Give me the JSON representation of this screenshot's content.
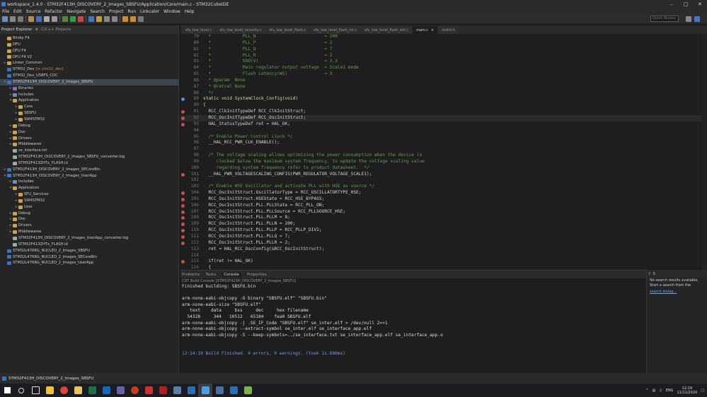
{
  "window": {
    "title": "workspace_1.4.0 - STM32F413H_DISCOVERY_2_Images_SBSFU/Application/Core/main.c - STM32CubeIDE"
  },
  "menu": [
    "File",
    "Edit",
    "Source",
    "Refactor",
    "Navigate",
    "Search",
    "Project",
    "Run",
    "Linkcalor",
    "Window",
    "Help"
  ],
  "toolbar": {
    "quick_access_placeholder": "Quick Access"
  },
  "left_tabs": {
    "project_explorer": "Project Explorer",
    "cpp_projects": "C/C++ Projects"
  },
  "tree": [
    {
      "label": "Blinky F4",
      "level": 0,
      "twisty": "",
      "icon": "folder"
    },
    {
      "label": "DFU",
      "level": 0,
      "twisty": "",
      "icon": "folder"
    },
    {
      "label": "DFU F4",
      "level": 0,
      "twisty": "",
      "icon": "folder"
    },
    {
      "label": "DFU F4 V2",
      "level": 0,
      "twisty": "",
      "icon": "folder"
    },
    {
      "label": "Linker_Common",
      "level": 0,
      "twisty": ">",
      "icon": "folder"
    },
    {
      "label": "STM32_Dev",
      "anno": "[in stm32_dev]",
      "level": 0,
      "twisty": "",
      "icon": "proj"
    },
    {
      "label": "STM32_Dev_USBFS_CDC",
      "level": 0,
      "twisty": "",
      "icon": "proj"
    },
    {
      "label": "STM32F413H_DISCOVERY_2_Images_SBSFU",
      "level": 0,
      "twisty": "v",
      "icon": "proj",
      "selected": true
    },
    {
      "label": "Binaries",
      "level": 1,
      "twisty": ">",
      "icon": "bin"
    },
    {
      "label": "Includes",
      "level": 1,
      "twisty": ">",
      "icon": "inc"
    },
    {
      "label": "Application",
      "level": 1,
      "twisty": "v",
      "icon": "folder"
    },
    {
      "label": "Core",
      "level": 2,
      "twisty": ">",
      "icon": "folder"
    },
    {
      "label": "SBSFU",
      "level": 2,
      "twisty": ">",
      "icon": "folder"
    },
    {
      "label": "SW4STM32",
      "level": 2,
      "twisty": ">",
      "icon": "folder"
    },
    {
      "label": "Debug",
      "level": 1,
      "twisty": ">",
      "icon": "folder"
    },
    {
      "label": "Doc",
      "level": 1,
      "twisty": ">",
      "icon": "folder"
    },
    {
      "label": "Drivers",
      "level": 1,
      "twisty": ">",
      "icon": "folder"
    },
    {
      "label": "Middlewares",
      "level": 1,
      "twisty": ">",
      "icon": "folder"
    },
    {
      "label": "se_interface.txt",
      "level": 1,
      "twisty": "",
      "icon": "file"
    },
    {
      "label": "STM32F413H_DISCOVERY_2_Images_SBSFU_converter.log",
      "level": 1,
      "twisty": "",
      "icon": "file"
    },
    {
      "label": "STM32F413ZHTx_FLASH.ld",
      "level": 1,
      "twisty": "",
      "icon": "file"
    },
    {
      "label": "STM32F413H_DISCOVERY_2_Images_SECoreBin",
      "level": 0,
      "twisty": ">",
      "icon": "proj"
    },
    {
      "label": "STM32F413H_DISCOVERY_2_Images_UserApp",
      "level": 0,
      "twisty": "v",
      "icon": "proj"
    },
    {
      "label": "Includes",
      "level": 1,
      "twisty": ">",
      "icon": "inc"
    },
    {
      "label": "Application",
      "level": 1,
      "twisty": "v",
      "icon": "folder"
    },
    {
      "label": "SFU_Services",
      "level": 2,
      "twisty": ">",
      "icon": "folder"
    },
    {
      "label": "SW4STM32",
      "level": 2,
      "twisty": ">",
      "icon": "folder"
    },
    {
      "label": "User",
      "level": 2,
      "twisty": ">",
      "icon": "folder"
    },
    {
      "label": "Debug",
      "level": 1,
      "twisty": ">",
      "icon": "folder"
    },
    {
      "label": "Doc",
      "level": 1,
      "twisty": ">",
      "icon": "folder"
    },
    {
      "label": "Drivers",
      "level": 1,
      "twisty": ">",
      "icon": "folder"
    },
    {
      "label": "Middlewares",
      "level": 1,
      "twisty": ">",
      "icon": "folder"
    },
    {
      "label": "STM32F413H_DISCOVERY_2_Images_UserApp_converter.log",
      "level": 1,
      "twisty": "",
      "icon": "file"
    },
    {
      "label": "STM32F413ZHTx_FLASH.ld",
      "level": 1,
      "twisty": "",
      "icon": "file"
    },
    {
      "label": "STM32L476RG_NUCLEO_2_Images_SBSFU",
      "level": 0,
      "twisty": "",
      "icon": "proj"
    },
    {
      "label": "STM32L476RG_NUCLEO_2_Images_SECoreBin",
      "level": 0,
      "twisty": "",
      "icon": "proj"
    },
    {
      "label": "STM32L476RG_NUCLEO_2_Images_UserApp",
      "level": 0,
      "twisty": "",
      "icon": "proj"
    }
  ],
  "editor_tabs": [
    {
      "label": "sfu_low_level.c"
    },
    {
      "label": "sfu_low_level_security.c"
    },
    {
      "label": "sfu_low_level_flash.c"
    },
    {
      "label": "sfu_low_level_flash_int.c"
    },
    {
      "label": "sfu_low_level_flash_ext.c"
    },
    {
      "label": "main.c",
      "active": true
    },
    {
      "label": "stdint.h"
    }
  ],
  "code": [
    {
      "n": "79",
      "t": "  *            PLL_N                          = 200",
      "c": "cm"
    },
    {
      "n": "80",
      "t": "  *            PLL_P                          = 2",
      "c": "cm"
    },
    {
      "n": "81",
      "t": "  *            PLL_Q                          = 7",
      "c": "cm"
    },
    {
      "n": "82",
      "t": "  *            PLL_R                          = 2",
      "c": "cm"
    },
    {
      "n": "83",
      "t": "  *            VDD(V)                         = 3.3",
      "c": "cm"
    },
    {
      "n": "84",
      "t": "  *            Main regulator output voltage  = Scale1 mode",
      "c": "cm"
    },
    {
      "n": "85",
      "t": "  *            Flash Latency(WS)              = 3",
      "c": "cm"
    },
    {
      "n": "86",
      "t": "  * @param  None",
      "c": "cm"
    },
    {
      "n": "87",
      "t": "  * @retval None",
      "c": "cm"
    },
    {
      "n": "88",
      "t": "  */",
      "c": "cm"
    },
    {
      "n": "89",
      "t": "static void SystemClock_Config(void)",
      "c": "fn",
      "fold": true,
      "marker": "info"
    },
    {
      "n": "90",
      "t": "{",
      "c": "pl"
    },
    {
      "n": "91",
      "t": "  RCC_ClkInitTypeDef RCC_ClkInitStruct;",
      "c": "pl",
      "marker": "bug"
    },
    {
      "n": "92",
      "t": "  RCC_OscInitTypeDef RCC_OscInitStruct;",
      "c": "pl",
      "marker": "bug",
      "hl": true
    },
    {
      "n": "93",
      "t": "  HAL_StatusTypeDef ret = HAL_OK;",
      "c": "pl",
      "marker": "bug"
    },
    {
      "n": "94",
      "t": "",
      "c": "pl"
    },
    {
      "n": "95",
      "t": "  /* Enable Power Control clock */",
      "c": "cm"
    },
    {
      "n": "96",
      "t": "  __HAL_RCC_PWR_CLK_ENABLE();",
      "c": "pl"
    },
    {
      "n": "97",
      "t": "",
      "c": "pl"
    },
    {
      "n": "98",
      "t": "  /* The voltage scaling allows optimizing the power consumption when the device is",
      "c": "cm",
      "fold": true
    },
    {
      "n": "99",
      "t": "     clocked below the maximum system frequency, to update the voltage scaling value",
      "c": "cm"
    },
    {
      "n": "100",
      "t": "     regarding system frequency refer to product datasheet.  */",
      "c": "cm"
    },
    {
      "n": "101",
      "t": "  __HAL_PWR_VOLTAGESCALING_CONFIG(PWR_REGULATOR_VOLTAGE_SCALE1);",
      "c": "pl",
      "marker": "bug"
    },
    {
      "n": "102",
      "t": "",
      "c": "pl"
    },
    {
      "n": "103",
      "t": "  /* Enable HSE Oscillator and activate PLL with HSE as source */",
      "c": "cm"
    },
    {
      "n": "104",
      "t": "  RCC_OscInitStruct.OscillatorType = RCC_OSCILLATORTYPE_HSE;",
      "c": "pl",
      "marker": "bug"
    },
    {
      "n": "105",
      "t": "  RCC_OscInitStruct.HSEState = RCC_HSE_BYPASS;",
      "c": "pl",
      "marker": "bug"
    },
    {
      "n": "106",
      "t": "  RCC_OscInitStruct.PLL.PLLState = RCC_PLL_ON;",
      "c": "pl",
      "marker": "bug"
    },
    {
      "n": "107",
      "t": "  RCC_OscInitStruct.PLL.PLLSource = RCC_PLLSOURCE_HSE;",
      "c": "pl",
      "marker": "bug"
    },
    {
      "n": "108",
      "t": "  RCC_OscInitStruct.PLL.PLLM = 8;",
      "c": "pl",
      "marker": "bug"
    },
    {
      "n": "109",
      "t": "  RCC_OscInitStruct.PLL.PLLN = 200;",
      "c": "pl",
      "marker": "bug"
    },
    {
      "n": "110",
      "t": "  RCC_OscInitStruct.PLL.PLLP = RCC_PLLP_DIV2;",
      "c": "pl",
      "marker": "bug"
    },
    {
      "n": "111",
      "t": "  RCC_OscInitStruct.PLL.PLLQ = 7;",
      "c": "pl",
      "marker": "bug"
    },
    {
      "n": "112",
      "t": "  RCC_OscInitStruct.PLL.PLLR = 2;",
      "c": "pl",
      "marker": "bug"
    },
    {
      "n": "113",
      "t": "  ret = HAL_RCC_OscConfig(&RCC_OscInitStruct);",
      "c": "pl"
    },
    {
      "n": "114",
      "t": "",
      "c": "pl"
    },
    {
      "n": "115",
      "t": "  if(ret != HAL_OK)",
      "c": "pl",
      "marker": "bug"
    },
    {
      "n": "116",
      "t": "  {",
      "c": "pl"
    }
  ],
  "console_tabs": {
    "problems": "Problems",
    "tasks": "Tasks",
    "console": "Console",
    "properties": "Properties"
  },
  "console_subtitle": "CDT Build Console [STM32F413H_DISCOVERY_2_Images_SBSFU]",
  "console_lines": [
    "Finished building: SBSFU.bin",
    "",
    "arm-none-eabi-objcopy -O binary \"SBSFU.elf\" \"SBSFU.bin\"",
    "arm-none-eabi-size \"SBSFU.elf\"",
    "   text    data     bss     dec     hex filename",
    "  54328     344   10512   65184    fea0 SBSFU.elf",
    "arm-none-eabi-objcopy -j .SE_IF_Code \"SBSFU.elf\" se_inter.elf > /dev/null 2>>1",
    "arm-none-eabi-objcopy --extract-symbol se_inter.elf se_interface_app.elf",
    "arm-none-eabi-objcopy -S --keep-symbols=../se_interface.txt se_interface_app.elf se_interface_app.o",
    "",
    "",
    "12:14:10 Build Finished. 0 errors, 0 warnings. (took 1s.680ms)"
  ],
  "search_panel": {
    "tab": "S",
    "no_results": "No search results available. Start a search from the",
    "link": "search dialog..."
  },
  "status": {
    "selection": "STM32F413H_DISCOVERY_2_Images_SBSFU"
  },
  "tray": {
    "lang": "ENG",
    "time": "12:19",
    "date": "11/11/2020"
  },
  "colors": {
    "comment": "#6a9955",
    "plain": "#d4d4d4",
    "func": "#dcdcaa",
    "keyword": "#569cd6",
    "accent": "#007acc"
  }
}
